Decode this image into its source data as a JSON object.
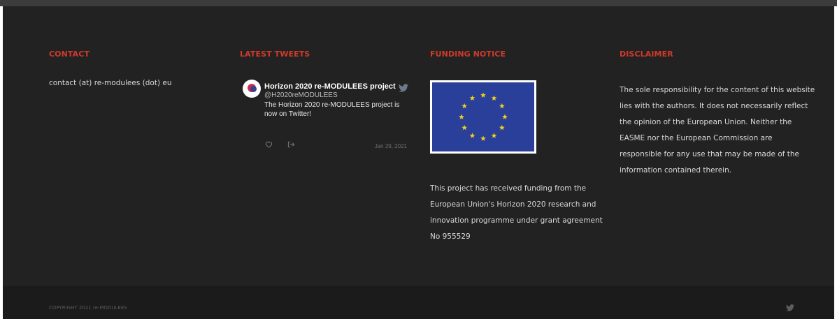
{
  "contact": {
    "heading": "CONTACT",
    "text": "contact (at) re-modulees (dot) eu"
  },
  "tweets": {
    "heading": "LATEST TWEETS",
    "items": [
      {
        "name": "Horizon 2020 re-MODULEES project",
        "handle": "@H2020reMODULEES",
        "text": "The Horizon 2020 re-MODULEES project is now on Twitter!",
        "date": "Jan 29, 2021",
        "icons": {
          "like": "heart-icon",
          "share": "share-icon",
          "platform": "twitter-bird-icon"
        }
      }
    ]
  },
  "funding": {
    "heading": "FUNDING NOTICE",
    "flag": "eu-flag",
    "text": "This project has received funding from the European Union's Horizon 2020 research and innovation programme under grant agreement No 955529"
  },
  "disclaimer": {
    "heading": "DISCLAIMER",
    "text": "The sole responsibility for the content of this website lies with the authors. It does not necessarily reflect the opinion of the European Union. Neither the EASME nor the European Commission are responsible for any use that may be made of the information contained therein."
  },
  "bottom_bar": {
    "copyright": "COPYRIGHT 2021 re-MODULEES",
    "social_icon": "twitter-bird-icon"
  },
  "colors": {
    "accent": "#d03a2a",
    "footer_bg": "#222222",
    "bottom_bg": "#1b1b1b",
    "eu_blue": "#2a3f9a",
    "eu_star": "#f3d21b"
  }
}
